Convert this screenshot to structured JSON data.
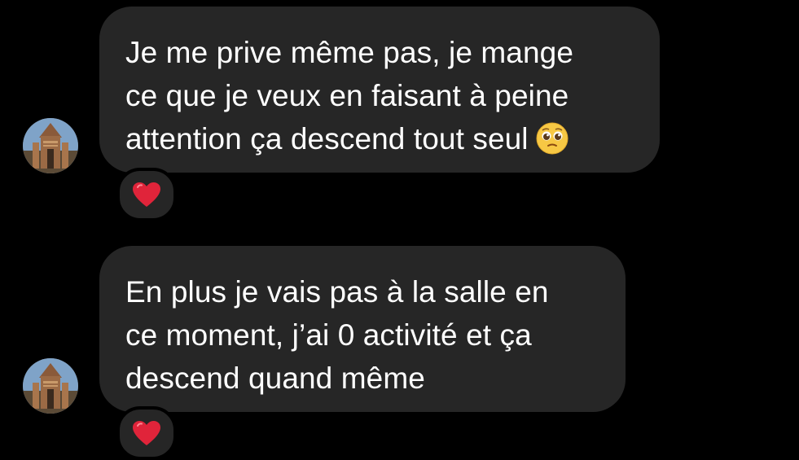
{
  "conversation": {
    "messages": [
      {
        "lines": [
          "Je me prive même pas, je mange",
          "ce que je veux en faisant à peine",
          "attention ça descend tout seul"
        ],
        "trailing_emoji": "pleading-face",
        "reaction": "red-heart"
      },
      {
        "lines": [
          "En plus je vais pas à la salle en",
          "ce moment, j’ai 0 activité et ça",
          "descend quand même"
        ],
        "reaction": "red-heart"
      }
    ]
  },
  "colors": {
    "background": "#000000",
    "bubble": "#262626",
    "text": "#ffffff",
    "heart": "#e0243a"
  }
}
